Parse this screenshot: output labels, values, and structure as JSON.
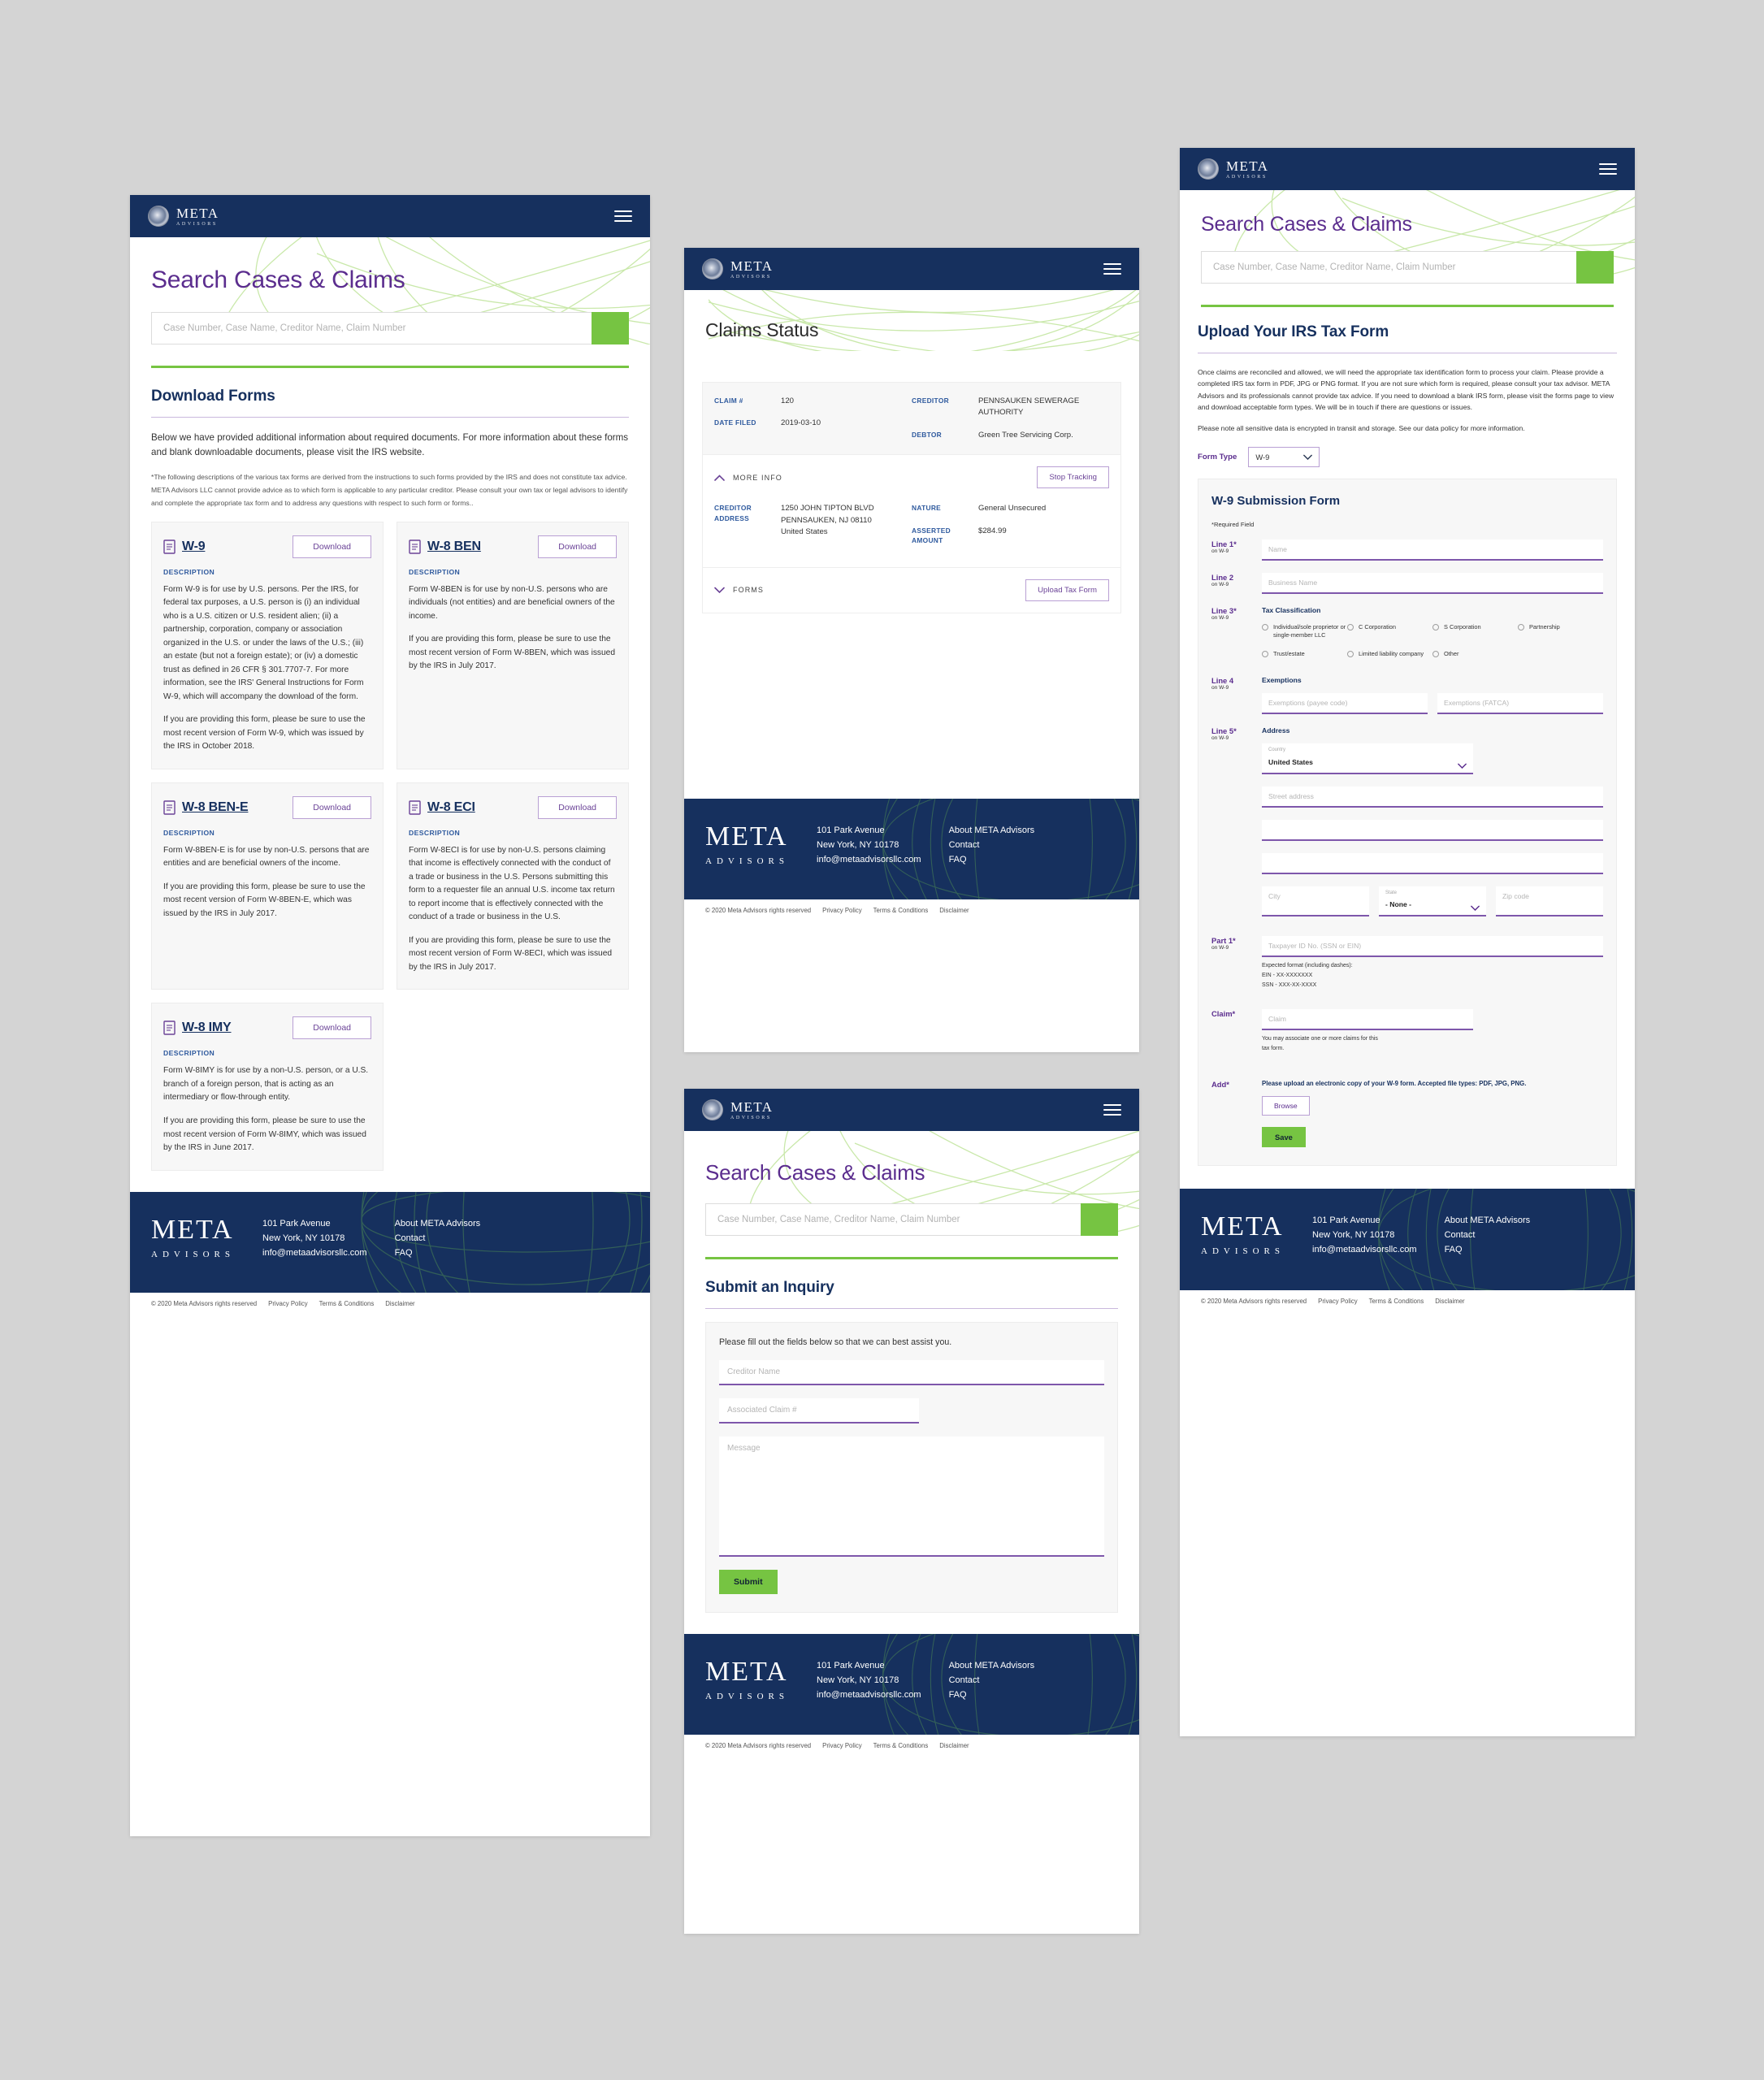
{
  "brand": {
    "name": "META",
    "tagline": "ADVISORS"
  },
  "screen1": {
    "page_title": "Search Cases & Claims",
    "search": {
      "placeholder": "Case Number, Case Name, Creditor Name, Claim Number",
      "icon": "search-icon"
    },
    "section_title": "Download Forms",
    "intro": "Below we have provided additional information about required documents. For more information about these forms and blank downloadable documents, please visit the IRS website.",
    "intro_link": "IRS website",
    "disclaimer": "*The following descriptions of the various tax forms are derived from the instructions to such forms provided by the IRS and does not constitute tax advice. META Advisors LLC cannot provide advice as to which form is applicable to any particular creditor. Please consult your own tax or legal advisors to identify and complete the appropriate tax form and to address any questions with respect to such form or forms..",
    "description_label": "DESCRIPTION",
    "download_label": "Download",
    "forms": [
      {
        "name": "W-9",
        "paragraphs": [
          "Form W-9 is for use by U.S. persons. Per the IRS, for federal tax purposes, a U.S. person is (i) an individual who is a U.S. citizen or U.S. resident alien; (ii) a partnership, corporation, company or association organized in the U.S. or under the laws of the U.S.; (iii) an estate (but not a foreign estate); or (iv) a domestic trust as defined in 26 CFR § 301.7707-7. For more information, see the IRS' General Instructions for Form W-9, which will accompany the download of the form.",
          "If you are providing this form, please be sure to use the most recent version of Form W-9, which was issued by the IRS in October 2018."
        ]
      },
      {
        "name": "W-8 BEN",
        "paragraphs": [
          "Form W-8BEN is for use by non-U.S. persons who are individuals (not entities) and are beneficial owners of the income.",
          "If you are providing this form, please be sure to use the most recent version of Form W-8BEN, which was issued by the IRS in July 2017."
        ]
      },
      {
        "name": "W-8 BEN-E",
        "paragraphs": [
          "Form W-8BEN-E is for use by non-U.S. persons that are entities and are beneficial owners of the income.",
          "If you are providing this form, please be sure to use the most recent version of Form W-8BEN-E, which was issued by the IRS in July 2017."
        ]
      },
      {
        "name": "W-8 ECI",
        "paragraphs": [
          "Form W-8ECI is for use by non-U.S. persons claiming that income is effectively connected with the conduct of a trade or business in the U.S. Persons submitting this form to a requester file an annual U.S. income tax return to report income that is effectively connected with the conduct of a trade or business in the U.S.",
          "If you are providing this form, please be sure to use the most recent version of Form W-8ECI, which was issued by the IRS in July 2017."
        ]
      },
      {
        "name": "W-8 IMY",
        "paragraphs": [
          "Form W-8IMY is for use by a non-U.S. person, or a U.S. branch of a foreign person, that is acting as an intermediary or flow-through entity.",
          "If you are providing this form, please be sure to use the most recent version of Form W-8IMY, which was issued by the IRS in June 2017."
        ]
      }
    ]
  },
  "screen2": {
    "page_title": "Claims Status",
    "claim": {
      "labels": {
        "claim_no": "CLAIM #",
        "date_filed": "DATE FILED",
        "creditor": "CREDITOR",
        "debtor": "DEBTOR",
        "creditor_address": "CREDITOR ADDRESS",
        "nature": "NATURE",
        "asserted_amount": "ASSERTED AMOUNT"
      },
      "claim_no": "120",
      "date_filed": "2019-03-10",
      "creditor": "PENNSAUKEN SEWERAGE AUTHORITY",
      "debtor": "Green Tree Servicing Corp.",
      "creditor_address": "1250 JOHN TIPTON BLVD\nPENNSAUKEN, NJ 08110\nUnited States",
      "nature": "General Unsecured",
      "asserted_amount": "$284.99",
      "more_info_label": "MORE INFO",
      "stop_tracking_label": "Stop Tracking",
      "forms_label": "FORMS",
      "upload_tax_form_label": "Upload Tax Form"
    }
  },
  "screen3": {
    "page_title": "Search Cases & Claims",
    "search": {
      "placeholder": "Case Number, Case Name, Creditor Name, Claim Number"
    },
    "section_title": "Submit an Inquiry",
    "note": "Please fill out the fields below so that we can best assist you.",
    "fields": {
      "creditor_name": "Creditor Name",
      "associated_claim": "Associated Claim #",
      "message": "Message"
    },
    "submit_label": "Submit"
  },
  "screen4": {
    "page_title": "Search Cases & Claims",
    "search": {
      "placeholder": "Case Number, Case Name, Creditor Name, Claim Number"
    },
    "section_title": "Upload Your IRS Tax Form",
    "para1": "Once claims are reconciled and allowed, we will need the appropriate tax identification form to process your claim. Please provide a completed IRS tax form in PDF, JPG or PNG format. If you are not sure which form is required, please consult your tax advisor. META Advisors and its professionals cannot provide tax advice. If you need to download a blank IRS form, please visit the forms page to view and download acceptable form types. We will be in touch if there are questions or issues.",
    "para2": "Please note all sensitive data is encrypted in transit and storage. See our data policy for more information.",
    "form_type_label": "Form Type",
    "form_type_value": "W-9",
    "form_title": "W-9 Submission Form",
    "required_note": "*Required Field",
    "lines": {
      "line1": {
        "label": "Line 1*",
        "sub": "on W-9",
        "placeholder": "Name"
      },
      "line2": {
        "label": "Line 2",
        "sub": "on W-9",
        "placeholder": "Business Name"
      },
      "line3": {
        "label": "Line 3*",
        "sub": "on W-9",
        "group": "Tax Classification",
        "options": [
          "Individual/sole proprietor or single-member LLC",
          "C Corporation",
          "S Corporation",
          "Partnership",
          "Trust/estate",
          "Limited liability company",
          "Other"
        ]
      },
      "line4": {
        "label": "Line 4",
        "sub": "on W-9",
        "group": "Exemptions",
        "placeholder_payee": "Exemptions (payee code)",
        "placeholder_fatca": "Exemptions (FATCA)"
      },
      "line5": {
        "label": "Line 5*",
        "sub": "on W-9",
        "group": "Address",
        "country_caption": "Country",
        "country_value": "United States",
        "street_placeholder": "Street address",
        "city_placeholder": "City",
        "state_caption": "State",
        "state_value": "- None -",
        "zip_placeholder": "Zip code"
      },
      "part1": {
        "label": "Part 1*",
        "sub": "on W-9",
        "placeholder": "Taxpayer ID No. (SSN or EIN)",
        "hint": "Expected format (including dashes):\nEIN - XX-XXXXXXX\nSSN - XXX-XX-XXXX"
      },
      "claim": {
        "label": "Claim*",
        "placeholder": "Claim",
        "hint": "You may associate one or more claims for this\ntax form."
      },
      "add": {
        "label": "Add*",
        "note": "Please upload an electronic copy of your W-9 form. Accepted file types: PDF, JPG, PNG.",
        "browse_label": "Browse"
      }
    },
    "save_label": "Save"
  },
  "footer": {
    "address_line1": "101 Park Avenue",
    "address_line2": "New York, NY 10178",
    "email": "info@metaadvisorsllc.com",
    "links": [
      "About META Advisors",
      "Contact",
      "FAQ"
    ],
    "copyright": "© 2020 Meta Advisors rights reserved",
    "legal": [
      "Privacy Policy",
      "Terms & Conditions",
      "Disclaimer"
    ]
  },
  "colors": {
    "navy": "#16305e",
    "green": "#76c442",
    "purple": "#5b2d8e",
    "accentPurple": "#7e57ab"
  }
}
